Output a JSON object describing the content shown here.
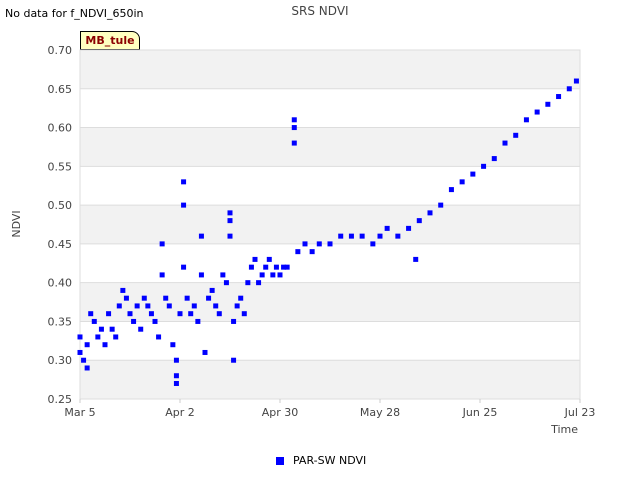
{
  "header": {
    "note": "No data for f_NDVI_650in",
    "site_tag": "MB_tule"
  },
  "chart_data": {
    "type": "scatter",
    "title": "SRS NDVI",
    "xlabel": "Time",
    "ylabel": "NDVI",
    "xlim": [
      "2024-03-05",
      "2024-07-23"
    ],
    "ylim": [
      0.25,
      0.7
    ],
    "x_ticks": [
      "Mar 5",
      "Apr 2",
      "Apr 30",
      "May 28",
      "Jun 25",
      "Jul 23"
    ],
    "y_ticks": [
      "0.25",
      "0.30",
      "0.35",
      "0.40",
      "0.45",
      "0.50",
      "0.55",
      "0.60",
      "0.65",
      "0.70"
    ],
    "grid": "horizontal bands",
    "legend_position": "bottom-center",
    "colors": {
      "series": "#0000ff",
      "band": "#f2f2f2"
    },
    "series": [
      {
        "name": "PAR-SW NDVI",
        "points": [
          [
            "2024-03-05",
            0.33
          ],
          [
            "2024-03-05",
            0.31
          ],
          [
            "2024-03-06",
            0.3
          ],
          [
            "2024-03-07",
            0.32
          ],
          [
            "2024-03-07",
            0.29
          ],
          [
            "2024-03-08",
            0.36
          ],
          [
            "2024-03-09",
            0.35
          ],
          [
            "2024-03-10",
            0.33
          ],
          [
            "2024-03-11",
            0.34
          ],
          [
            "2024-03-12",
            0.32
          ],
          [
            "2024-03-13",
            0.36
          ],
          [
            "2024-03-14",
            0.34
          ],
          [
            "2024-03-15",
            0.33
          ],
          [
            "2024-03-16",
            0.37
          ],
          [
            "2024-03-17",
            0.39
          ],
          [
            "2024-03-18",
            0.38
          ],
          [
            "2024-03-19",
            0.36
          ],
          [
            "2024-03-20",
            0.35
          ],
          [
            "2024-03-21",
            0.37
          ],
          [
            "2024-03-22",
            0.34
          ],
          [
            "2024-03-23",
            0.38
          ],
          [
            "2024-03-24",
            0.37
          ],
          [
            "2024-03-25",
            0.36
          ],
          [
            "2024-03-26",
            0.35
          ],
          [
            "2024-03-27",
            0.33
          ],
          [
            "2024-03-28",
            0.45
          ],
          [
            "2024-03-28",
            0.41
          ],
          [
            "2024-03-29",
            0.38
          ],
          [
            "2024-03-30",
            0.37
          ],
          [
            "2024-03-31",
            0.32
          ],
          [
            "2024-04-01",
            0.3
          ],
          [
            "2024-04-01",
            0.28
          ],
          [
            "2024-04-01",
            0.27
          ],
          [
            "2024-04-02",
            0.36
          ],
          [
            "2024-04-03",
            0.53
          ],
          [
            "2024-04-03",
            0.5
          ],
          [
            "2024-04-03",
            0.42
          ],
          [
            "2024-04-04",
            0.38
          ],
          [
            "2024-04-05",
            0.36
          ],
          [
            "2024-04-06",
            0.37
          ],
          [
            "2024-04-07",
            0.35
          ],
          [
            "2024-04-08",
            0.46
          ],
          [
            "2024-04-08",
            0.41
          ],
          [
            "2024-04-09",
            0.31
          ],
          [
            "2024-04-10",
            0.38
          ],
          [
            "2024-04-11",
            0.39
          ],
          [
            "2024-04-12",
            0.37
          ],
          [
            "2024-04-13",
            0.36
          ],
          [
            "2024-04-14",
            0.41
          ],
          [
            "2024-04-15",
            0.4
          ],
          [
            "2024-04-16",
            0.49
          ],
          [
            "2024-04-16",
            0.48
          ],
          [
            "2024-04-16",
            0.46
          ],
          [
            "2024-04-17",
            0.35
          ],
          [
            "2024-04-17",
            0.3
          ],
          [
            "2024-04-18",
            0.37
          ],
          [
            "2024-04-19",
            0.38
          ],
          [
            "2024-04-20",
            0.36
          ],
          [
            "2024-04-21",
            0.4
          ],
          [
            "2024-04-22",
            0.42
          ],
          [
            "2024-04-23",
            0.43
          ],
          [
            "2024-04-24",
            0.4
          ],
          [
            "2024-04-25",
            0.41
          ],
          [
            "2024-04-26",
            0.42
          ],
          [
            "2024-04-27",
            0.43
          ],
          [
            "2024-04-28",
            0.41
          ],
          [
            "2024-04-29",
            0.42
          ],
          [
            "2024-04-30",
            0.41
          ],
          [
            "2024-05-01",
            0.42
          ],
          [
            "2024-05-02",
            0.42
          ],
          [
            "2024-05-04",
            0.61
          ],
          [
            "2024-05-04",
            0.6
          ],
          [
            "2024-05-04",
            0.58
          ],
          [
            "2024-05-05",
            0.44
          ],
          [
            "2024-05-07",
            0.45
          ],
          [
            "2024-05-09",
            0.44
          ],
          [
            "2024-05-11",
            0.45
          ],
          [
            "2024-05-14",
            0.45
          ],
          [
            "2024-05-17",
            0.46
          ],
          [
            "2024-05-20",
            0.46
          ],
          [
            "2024-05-23",
            0.46
          ],
          [
            "2024-05-26",
            0.45
          ],
          [
            "2024-05-28",
            0.46
          ],
          [
            "2024-05-30",
            0.47
          ],
          [
            "2024-06-02",
            0.46
          ],
          [
            "2024-06-05",
            0.47
          ],
          [
            "2024-06-07",
            0.43
          ],
          [
            "2024-06-08",
            0.48
          ],
          [
            "2024-06-11",
            0.49
          ],
          [
            "2024-06-14",
            0.5
          ],
          [
            "2024-06-17",
            0.52
          ],
          [
            "2024-06-20",
            0.53
          ],
          [
            "2024-06-23",
            0.54
          ],
          [
            "2024-06-26",
            0.55
          ],
          [
            "2024-06-29",
            0.56
          ],
          [
            "2024-07-02",
            0.58
          ],
          [
            "2024-07-05",
            0.59
          ],
          [
            "2024-07-08",
            0.61
          ],
          [
            "2024-07-11",
            0.62
          ],
          [
            "2024-07-14",
            0.63
          ],
          [
            "2024-07-17",
            0.64
          ],
          [
            "2024-07-20",
            0.65
          ],
          [
            "2024-07-22",
            0.66
          ]
        ]
      }
    ]
  }
}
